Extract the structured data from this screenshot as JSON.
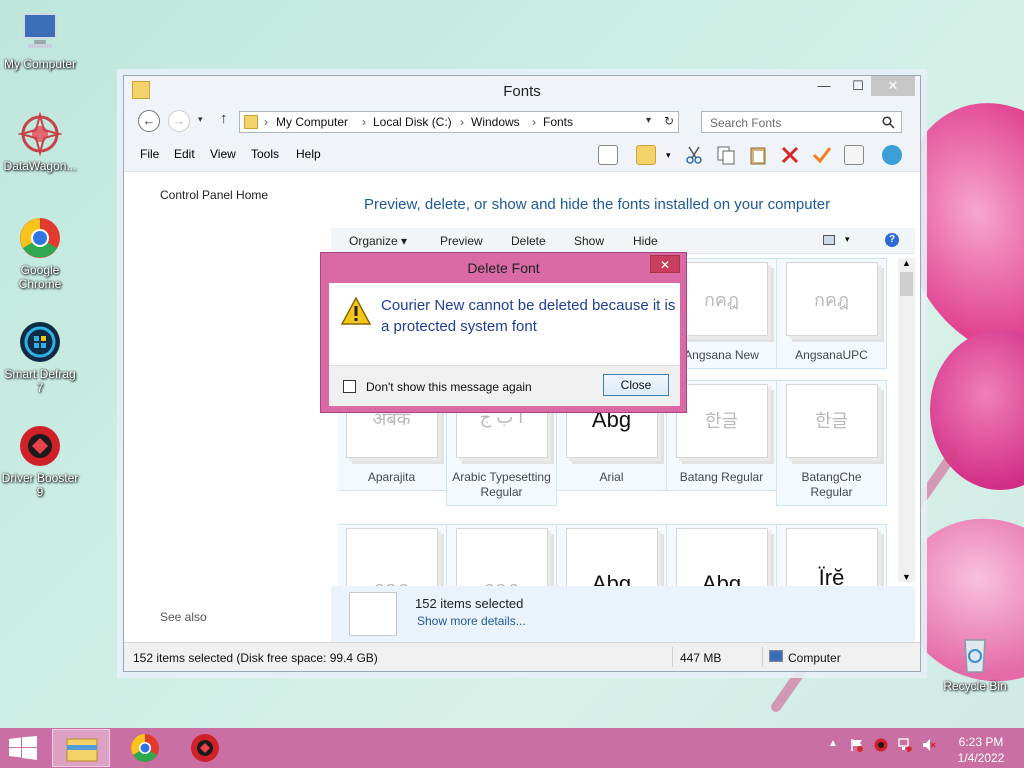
{
  "desktop": {
    "icons": [
      {
        "label": "My Computer"
      },
      {
        "label": "DataWagon..."
      },
      {
        "label": "Google Chrome"
      },
      {
        "label": "Smart Defrag 7"
      },
      {
        "label": "Driver Booster 9"
      },
      {
        "label": "Recycle Bin"
      }
    ]
  },
  "window": {
    "title": "Fonts",
    "address": {
      "crumbs": [
        "My Computer",
        "Local Disk (C:)",
        "Windows",
        "Fonts"
      ]
    },
    "search_placeholder": "Search Fonts",
    "menu": [
      "File",
      "Edit",
      "View",
      "Tools",
      "Help"
    ],
    "left_pane": {
      "control_panel_home": "Control Panel Home",
      "see_also": "See also"
    },
    "headline": "Preview, delete, or show and hide the fonts installed on your computer",
    "commands": [
      "Organize ▾",
      "Preview",
      "Delete",
      "Show",
      "Hide"
    ],
    "fonts": [
      {
        "name": "Angsana New",
        "glyph": "กคฎ"
      },
      {
        "name": "AngsanaUPC",
        "glyph": "กคฎ"
      },
      {
        "name": "Aparajita",
        "glyph": "अबक"
      },
      {
        "name": "Arabic Typesetting Regular",
        "glyph": "أ ب ج"
      },
      {
        "name": "Arial",
        "glyph": "Abg"
      },
      {
        "name": "Batang Regular",
        "glyph": "한글"
      },
      {
        "name": "BatangChe Regular",
        "glyph": "한글"
      },
      {
        "name": "",
        "glyph": "กคฎ"
      },
      {
        "name": "",
        "glyph": "กคฎ"
      },
      {
        "name": "",
        "glyph": "Abg"
      },
      {
        "name": "",
        "glyph": "Abg"
      },
      {
        "name": "",
        "glyph": "Ïrĕ"
      }
    ],
    "details": {
      "count": "152 items selected",
      "more": "Show more details..."
    },
    "status": {
      "left": "152 items selected (Disk free space: 99.4 GB)",
      "size": "447 MB",
      "location": "Computer"
    }
  },
  "dialog": {
    "title": "Delete Font",
    "close": "✕",
    "message": "Courier New cannot be deleted because it is a protected system font",
    "checkbox_label": "Don't show this message again",
    "button": "Close"
  },
  "taskbar": {
    "time": "6:23 PM",
    "date": "1/4/2022"
  },
  "colors": {
    "accent": "#c96fa3",
    "dialog_frame": "#d96aa6",
    "link": "#1e5a99"
  }
}
